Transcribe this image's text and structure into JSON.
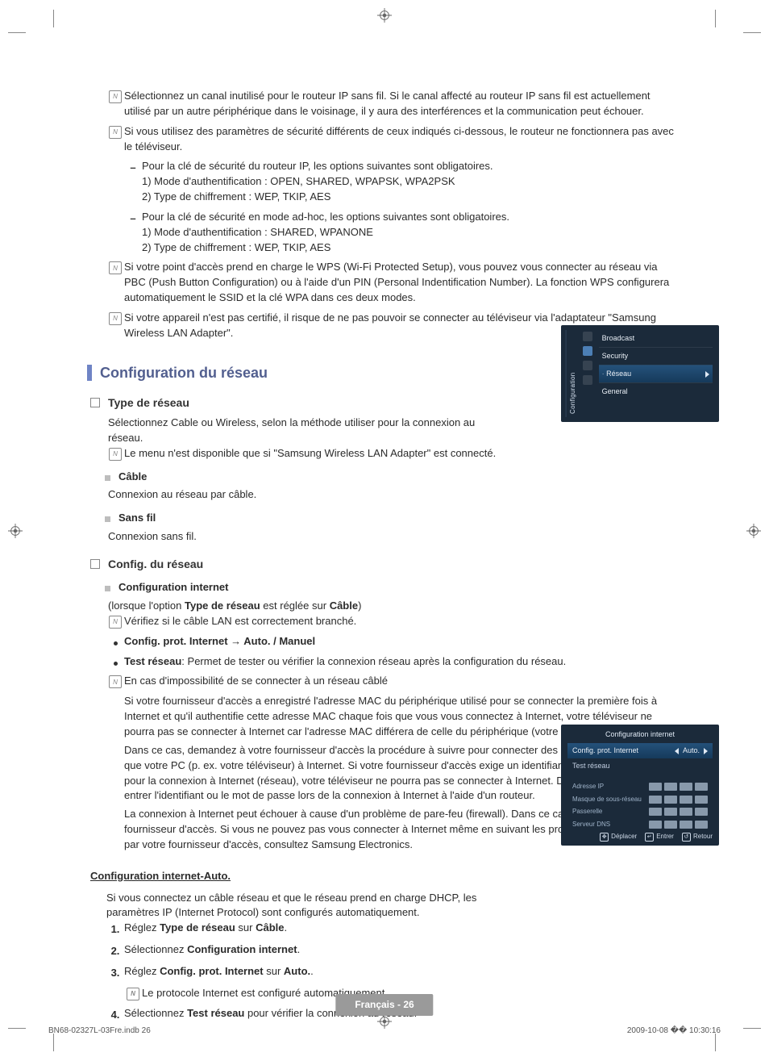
{
  "notes_top": [
    "Sélectionnez un canal inutilisé pour le routeur IP sans fil. Si le canal affecté au routeur IP sans fil est actuellement utilisé par un autre périphérique dans le voisinage, il y aura des interférences et la communication peut échouer.",
    "Si vous utilisez des paramètres de sécurité différents de ceux indiqués ci-dessous, le routeur ne fonctionnera pas avec le téléviseur."
  ],
  "sec_options": {
    "router": {
      "intro": "Pour la clé de sécurité du routeur IP, les options suivantes sont obligatoires.",
      "lines": [
        "1) Mode d'authentification : OPEN, SHARED, WPAPSK, WPA2PSK",
        "2) Type de chiffrement : WEP, TKIP, AES"
      ]
    },
    "adhoc": {
      "intro": "Pour la clé de sécurité en mode ad-hoc, les options suivantes sont obligatoires.",
      "lines": [
        "1) Mode d'authentification : SHARED, WPANONE",
        "2) Type de chiffrement : WEP, TKIP, AES"
      ]
    }
  },
  "notes_after_sec": [
    "Si votre point d'accès prend en charge le WPS (Wi-Fi Protected Setup), vous pouvez vous connecter au réseau via PBC (Push Button Configuration) ou à l'aide d'un PIN (Personal Indentification Number). La fonction WPS configurera automatiquement le SSID et la clé WPA dans ces deux modes.",
    "Si votre appareil n'est pas certifié, il risque de ne pas pouvoir se connecter au téléviseur via l'adaptateur \"Samsung Wireless LAN Adapter\"."
  ],
  "section_title": "Configuration du réseau",
  "type_reseau": {
    "title": "Type de réseau",
    "intro": "Sélectionnez Cable ou Wireless, selon la méthode utiliser pour la connexion au réseau.",
    "note": "Le menu n'est disponible que si \"Samsung Wireless LAN Adapter\" est connecté.",
    "cable_title": "Câble",
    "cable_text": "Connexion au réseau par câble.",
    "sansfil_title": "Sans fil",
    "sansfil_text": "Connexion sans fil."
  },
  "config_reseau": {
    "title": "Config. du réseau",
    "conf_internet": "Configuration internet",
    "conf_internet_sub_pre": "(lorsque l'option ",
    "conf_internet_sub_b1": "Type de réseau",
    "conf_internet_sub_mid": " est réglée sur ",
    "conf_internet_sub_b2": "Câble",
    "conf_internet_sub_post": ")",
    "note1": "Vérifiez si le câble LAN est correctement branché.",
    "bullet1": "Config. prot. Internet → Auto. / Manuel",
    "bullet2_b": "Test réseau",
    "bullet2_rest": ": Permet de tester ou vérifier la connexion réseau après la configuration du réseau.",
    "note2": "En cas d'impossibilité de se connecter à un réseau câblé",
    "para1": "Si votre fournisseur d'accès a enregistré l'adresse MAC du périphérique utilisé pour se connecter la première fois à Internet et qu'il authentifie cette adresse MAC chaque fois que vous vous connectez à Internet, votre téléviseur ne pourra pas se connecter à Internet car l'adresse MAC différera de celle du périphérique (votre PC).",
    "para2": "Dans ce cas, demandez à votre fournisseur d'accès la procédure à suivre pour connecter des périphériques autres que votre PC (p. ex. votre téléviseur) à Internet. Si votre fournisseur d'accès exige un identifiant ou un mot de passe pour la connexion à Internet (réseau), votre téléviseur ne pourra pas se connecter à Internet. Dans ce cas, vous devez entrer l'identifiant ou le mot de passe lors de la connexion à Internet à l'aide d'un routeur.",
    "para3": "La connexion à Internet peut échouer à cause d'un problème de pare-feu (firewall). Dans ce cas, contactez votre fournisseur d'accès. Si vous ne pouvez pas vous connecter à Internet même en suivant les procédures communiquées par votre fournisseur d'accès, consultez Samsung Electronics."
  },
  "auto": {
    "title": "Configuration internet-Auto.",
    "intro": "Si vous connectez un câble réseau et que le réseau prend en charge DHCP, les paramètres IP (Internet Protocol) sont configurés automatiquement.",
    "steps": [
      {
        "pre": "Réglez ",
        "b": "Type de réseau",
        "mid": " sur ",
        "b2": "Câble",
        "post": "."
      },
      {
        "pre": "Sélectionnez ",
        "b": "Configuration internet",
        "mid": "",
        "b2": "",
        "post": "."
      },
      {
        "pre": "Réglez ",
        "b": "Config. prot. Internet",
        "mid": " sur ",
        "b2": "Auto.",
        "post": "."
      }
    ],
    "step3_note": "Le protocole Internet est configuré automatiquement.",
    "step4_pre": "Sélectionnez ",
    "step4_b": "Test réseau",
    "step4_post": " pour vérifier la connexion au réseau."
  },
  "shot1": {
    "tab": "Configuration",
    "items": [
      "Broadcast",
      "Security",
      "Réseau",
      "General"
    ],
    "selected_index": 2
  },
  "shot2": {
    "title": "Configuration internet",
    "row1_label": "Config. prot. Internet",
    "row1_value": "Auto.",
    "row2_label": "Test réseau",
    "fields": [
      "Adresse IP",
      "Masque de sous-réseau",
      "Passerelle",
      "Serveur DNS"
    ],
    "footer": {
      "move": "Déplacer",
      "enter": "Entrer",
      "return": "Retour"
    }
  },
  "page_footer": "Français - 26",
  "foot_left": "BN68-02327L-03Fre.indb   26",
  "foot_right": "2009-10-08   �� 10:30:16"
}
